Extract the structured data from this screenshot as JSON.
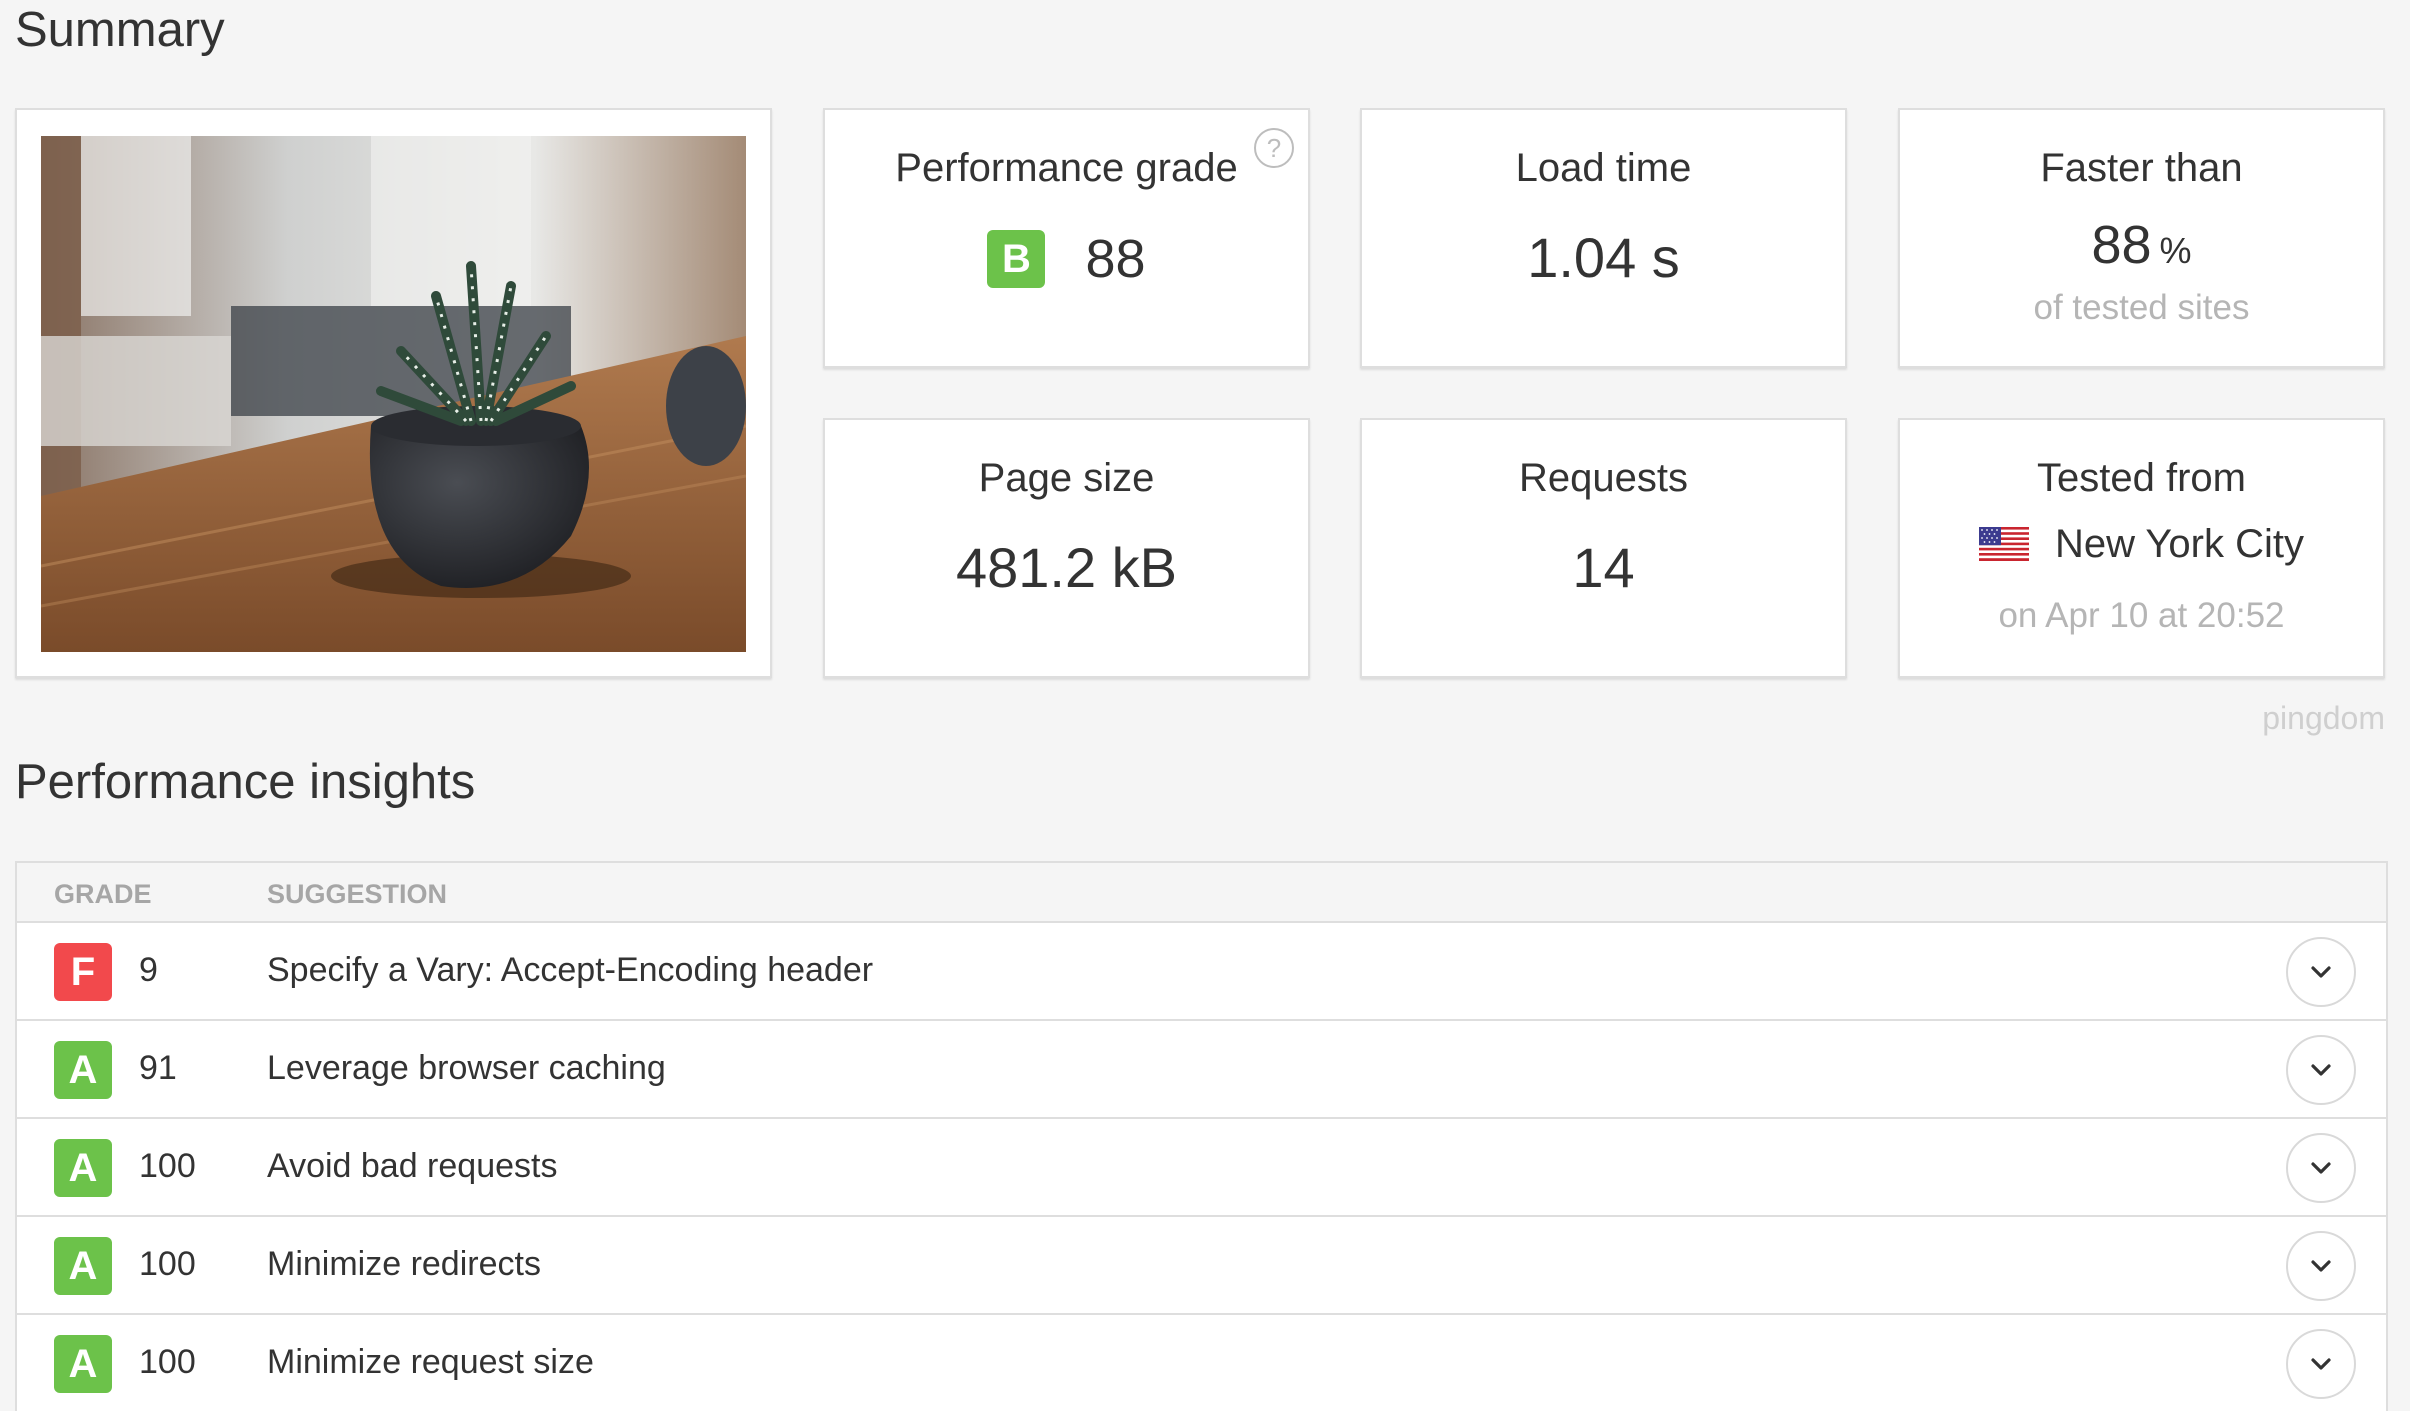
{
  "summary": {
    "title": "Summary",
    "performance_grade": {
      "label": "Performance grade",
      "letter": "B",
      "value": "88",
      "help_icon": "question-icon",
      "color": "#6cc24a"
    },
    "load_time": {
      "label": "Load time",
      "value": "1.04 s"
    },
    "faster_than": {
      "label": "Faster than",
      "value": "88",
      "unit": "%",
      "sub": "of tested sites"
    },
    "page_size": {
      "label": "Page size",
      "value": "481.2 kB"
    },
    "requests": {
      "label": "Requests",
      "value": "14"
    },
    "tested_from": {
      "label": "Tested from",
      "flag_icon": "us-flag-icon",
      "location": "New York City",
      "when": "on Apr 10 at 20:52"
    },
    "brand": "pingdom"
  },
  "insights": {
    "title": "Performance insights",
    "columns": {
      "grade": "GRADE",
      "suggestion": "SUGGESTION"
    },
    "rows": [
      {
        "letter": "F",
        "score": "9",
        "text": "Specify a Vary: Accept-Encoding header",
        "color": "#f2494c"
      },
      {
        "letter": "A",
        "score": "91",
        "text": "Leverage browser caching",
        "color": "#6cc24a"
      },
      {
        "letter": "A",
        "score": "100",
        "text": "Avoid bad requests",
        "color": "#6cc24a"
      },
      {
        "letter": "A",
        "score": "100",
        "text": "Minimize redirects",
        "color": "#6cc24a"
      },
      {
        "letter": "A",
        "score": "100",
        "text": "Minimize request size",
        "color": "#6cc24a"
      }
    ]
  }
}
